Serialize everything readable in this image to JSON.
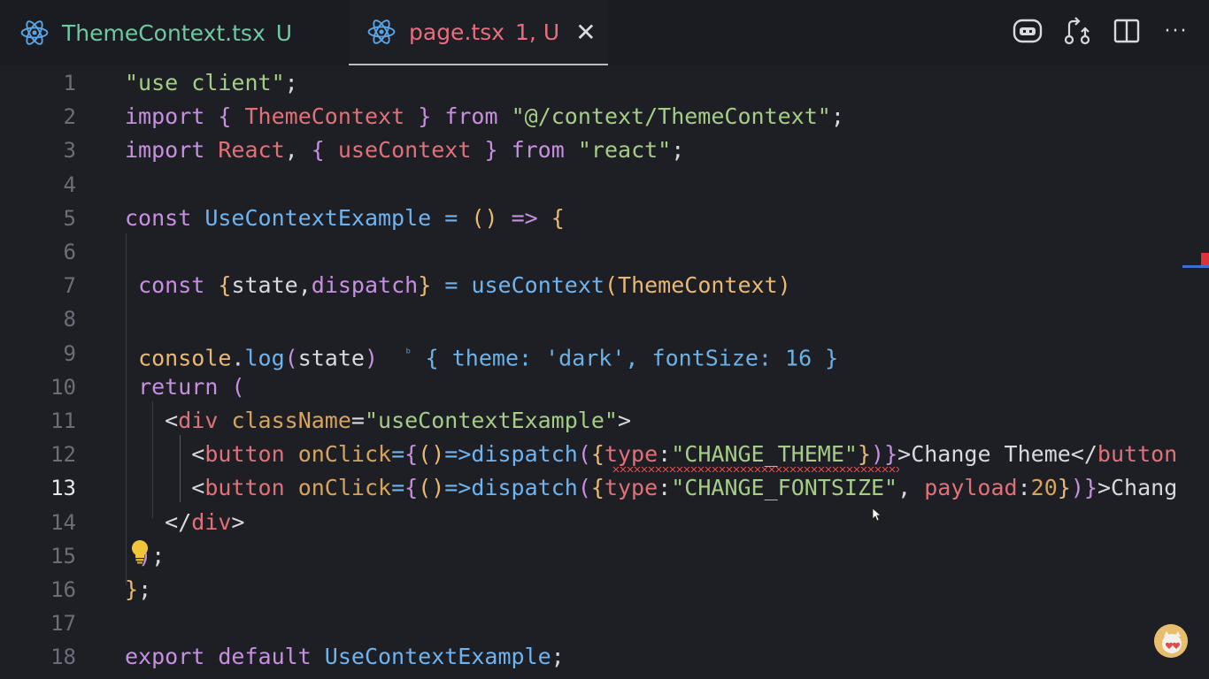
{
  "tabs": [
    {
      "name": "ThemeContext.tsx",
      "flag": "U"
    },
    {
      "name": "page.tsx",
      "flag": "1, U",
      "close": "✕"
    }
  ],
  "actions": [
    {
      "icon": "copilot-icon"
    },
    {
      "icon": "source-control-compare-icon"
    },
    {
      "icon": "split-editor-icon"
    },
    {
      "icon": "more-actions-icon",
      "glyph": "···"
    }
  ],
  "editor": {
    "active_line": 13,
    "line_numbers": [
      "1",
      "2",
      "3",
      "4",
      "5",
      "6",
      "7",
      "8",
      "9",
      "10",
      "11",
      "12",
      "13",
      "14",
      "15",
      "16",
      "17",
      "18"
    ],
    "lines": [
      {
        "n": 1,
        "tokens": [
          [
            "str",
            "\"use client\""
          ],
          [
            "pl",
            ";"
          ]
        ]
      },
      {
        "n": 2,
        "tokens": [
          [
            "kw",
            "import"
          ],
          [
            "pl",
            " "
          ],
          [
            "brace",
            "{"
          ],
          [
            "pl",
            " "
          ],
          [
            "var",
            "ThemeContext"
          ],
          [
            "pl",
            " "
          ],
          [
            "brace",
            "}"
          ],
          [
            "pl",
            " "
          ],
          [
            "kw",
            "from"
          ],
          [
            "pl",
            " "
          ],
          [
            "str",
            "\"@/context/ThemeContext\""
          ],
          [
            "pl",
            ";"
          ]
        ]
      },
      {
        "n": 3,
        "tokens": [
          [
            "kw",
            "import"
          ],
          [
            "pl",
            " "
          ],
          [
            "var",
            "React"
          ],
          [
            "pl",
            ", "
          ],
          [
            "brace",
            "{"
          ],
          [
            "pl",
            " "
          ],
          [
            "var",
            "useContext"
          ],
          [
            "pl",
            " "
          ],
          [
            "brace",
            "}"
          ],
          [
            "pl",
            " "
          ],
          [
            "kw",
            "from"
          ],
          [
            "pl",
            " "
          ],
          [
            "str",
            "\"react\""
          ],
          [
            "pl",
            ";"
          ]
        ]
      },
      {
        "n": 4,
        "tokens": []
      },
      {
        "n": 5,
        "tokens": [
          [
            "kw",
            "const"
          ],
          [
            "pl",
            " "
          ],
          [
            "fn",
            "UseContextExample"
          ],
          [
            "pl",
            " "
          ],
          [
            "fn",
            "="
          ],
          [
            "pl",
            " "
          ],
          [
            "cls",
            "()"
          ],
          [
            "pl",
            " "
          ],
          [
            "kw",
            "=>"
          ],
          [
            "pl",
            " "
          ],
          [
            "cls",
            "{"
          ]
        ]
      },
      {
        "n": 6,
        "tokens": []
      },
      {
        "n": 7,
        "tokens": [
          [
            "pl",
            " "
          ],
          [
            "kw",
            "const"
          ],
          [
            "pl",
            " "
          ],
          [
            "cls",
            "{"
          ],
          [
            "pl",
            "state,"
          ],
          [
            "kw",
            "dispatch"
          ],
          [
            "cls",
            "}"
          ],
          [
            "pl",
            " "
          ],
          [
            "fn",
            "="
          ],
          [
            "pl",
            " "
          ],
          [
            "fn",
            "useContext"
          ],
          [
            "cls",
            "("
          ],
          [
            "cls",
            "ThemeContext"
          ],
          [
            "cls",
            ")"
          ]
        ]
      },
      {
        "n": 8,
        "tokens": []
      },
      {
        "n": 9,
        "tokens": [
          [
            "pl",
            " "
          ],
          [
            "cls",
            "console"
          ],
          [
            "pl",
            "."
          ],
          [
            "fn",
            "log"
          ],
          [
            "kw",
            "("
          ],
          [
            "pl",
            "state"
          ],
          [
            "kw",
            ")"
          ]
        ]
      },
      {
        "n": 10,
        "tokens": [
          [
            "pl",
            " "
          ],
          [
            "kw",
            "return"
          ],
          [
            "pl",
            " "
          ],
          [
            "kw",
            "("
          ]
        ]
      },
      {
        "n": 11,
        "tokens": [
          [
            "pl",
            "   "
          ],
          [
            "pl",
            "<"
          ],
          [
            "tag",
            "div"
          ],
          [
            "pl",
            " "
          ],
          [
            "attr",
            "className"
          ],
          [
            "pl",
            "="
          ],
          [
            "str",
            "\"useContextExample\""
          ],
          [
            "pl",
            ">"
          ]
        ]
      },
      {
        "n": 12,
        "tokens": [
          [
            "pl",
            "     "
          ],
          [
            "pl",
            "<"
          ],
          [
            "tag",
            "button"
          ],
          [
            "pl",
            " "
          ],
          [
            "attr",
            "onClick"
          ],
          [
            "fn",
            "="
          ],
          [
            "kw",
            "{"
          ],
          [
            "cls",
            "()"
          ],
          [
            "fn",
            "=>"
          ],
          [
            "fn",
            "dispatch"
          ],
          [
            "kw",
            "("
          ],
          [
            "cls",
            "{"
          ],
          [
            "var",
            "type"
          ],
          [
            "pl",
            ":"
          ],
          [
            "str",
            "\"CHANGE_THEME\""
          ],
          [
            "cls",
            "}"
          ],
          [
            "kw",
            ")"
          ],
          [
            "kw",
            "}"
          ],
          [
            "pl",
            ">Change Theme</"
          ],
          [
            "tag",
            "button"
          ]
        ]
      },
      {
        "n": 13,
        "tokens": [
          [
            "pl",
            "     "
          ],
          [
            "pl",
            "<"
          ],
          [
            "tag",
            "button"
          ],
          [
            "pl",
            " "
          ],
          [
            "attr",
            "onClick"
          ],
          [
            "fn",
            "="
          ],
          [
            "kw",
            "{"
          ],
          [
            "cls",
            "()"
          ],
          [
            "fn",
            "=>"
          ],
          [
            "fn",
            "dispatch"
          ],
          [
            "kw",
            "("
          ],
          [
            "cls",
            "{"
          ],
          [
            "var",
            "type"
          ],
          [
            "pl",
            ":"
          ],
          [
            "str",
            "\"CHANGE_FONTSIZE\""
          ],
          [
            "pl",
            ", "
          ],
          [
            "var",
            "payload"
          ],
          [
            "pl",
            ":"
          ],
          [
            "num",
            "20"
          ],
          [
            "cls",
            "}"
          ],
          [
            "kw",
            ")"
          ],
          [
            "kw",
            "}"
          ],
          [
            "pl",
            ">Chang"
          ]
        ]
      },
      {
        "n": 14,
        "tokens": [
          [
            "pl",
            "   "
          ],
          [
            "pl",
            "</"
          ],
          [
            "tag",
            "div"
          ],
          [
            "pl",
            ">"
          ]
        ]
      },
      {
        "n": 15,
        "tokens": [
          [
            "pl",
            " "
          ],
          [
            "kw",
            ")"
          ],
          [
            "pl",
            ";"
          ]
        ]
      },
      {
        "n": 16,
        "tokens": [
          [
            "cls",
            "}"
          ],
          [
            "pl",
            ";"
          ]
        ]
      },
      {
        "n": 17,
        "tokens": []
      },
      {
        "n": 18,
        "tokens": [
          [
            "kw",
            "export"
          ],
          [
            "pl",
            " "
          ],
          [
            "kw",
            "default"
          ],
          [
            "pl",
            " "
          ],
          [
            "fn",
            "UseContextExample"
          ],
          [
            "pl",
            ";"
          ]
        ]
      }
    ],
    "inline_hint": {
      "marker": "ᵇ",
      "text": "{ theme: 'dark', fontSize: 16 }"
    }
  }
}
